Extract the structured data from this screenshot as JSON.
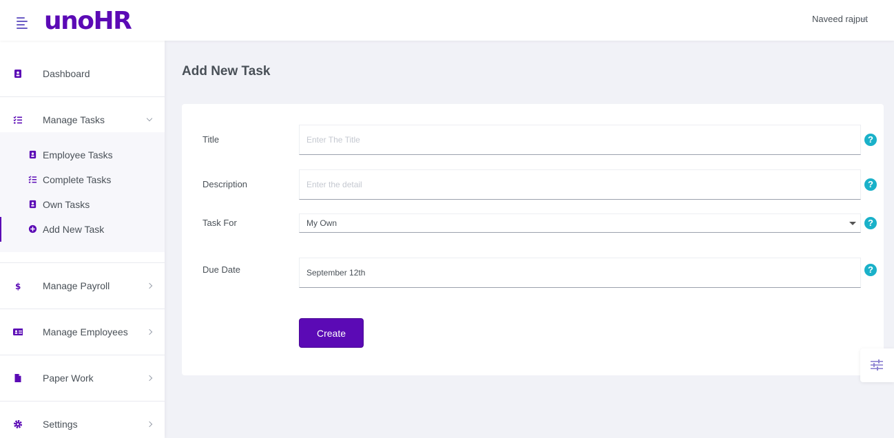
{
  "brand": {
    "logo_text": "unoHR",
    "accent_color": "#5b0ab5"
  },
  "header": {
    "user_name": "Naveed rajput",
    "menu_icon": "hamburger-icon",
    "user_menu_icon": "chevron-down-icon"
  },
  "sidebar": {
    "items": [
      {
        "label": "Dashboard",
        "icon": "contact-card-icon"
      },
      {
        "label": "Manage Tasks",
        "icon": "task-list-icon",
        "expanded": true
      },
      {
        "label": "Manage Payroll",
        "icon": "dollar-icon"
      },
      {
        "label": "Manage Employees",
        "icon": "id-card-icon"
      },
      {
        "label": "Paper Work",
        "icon": "file-icon"
      },
      {
        "label": "Settings",
        "icon": "gear-icon"
      }
    ],
    "submenu": [
      {
        "label": "Employee Tasks",
        "icon": "contact-card-icon"
      },
      {
        "label": "Complete Tasks",
        "icon": "task-list-icon"
      },
      {
        "label": "Own Tasks",
        "icon": "contact-card-icon"
      },
      {
        "label": "Add New Task",
        "icon": "plus-circle-icon",
        "active": true
      }
    ]
  },
  "page": {
    "title": "Add New Task"
  },
  "form": {
    "title": {
      "label": "Title",
      "placeholder": "Enter The Title",
      "value": ""
    },
    "description": {
      "label": "Description",
      "placeholder": "Enter the detail",
      "value": ""
    },
    "task_for": {
      "label": "Task For",
      "selected": "My Own"
    },
    "due_date": {
      "label": "Due Date",
      "value": "September 12th"
    },
    "help_glyph": "?",
    "help_color": "#1ab1c9",
    "submit_label": "Create"
  },
  "floating_button": {
    "icon": "sliders-icon"
  }
}
